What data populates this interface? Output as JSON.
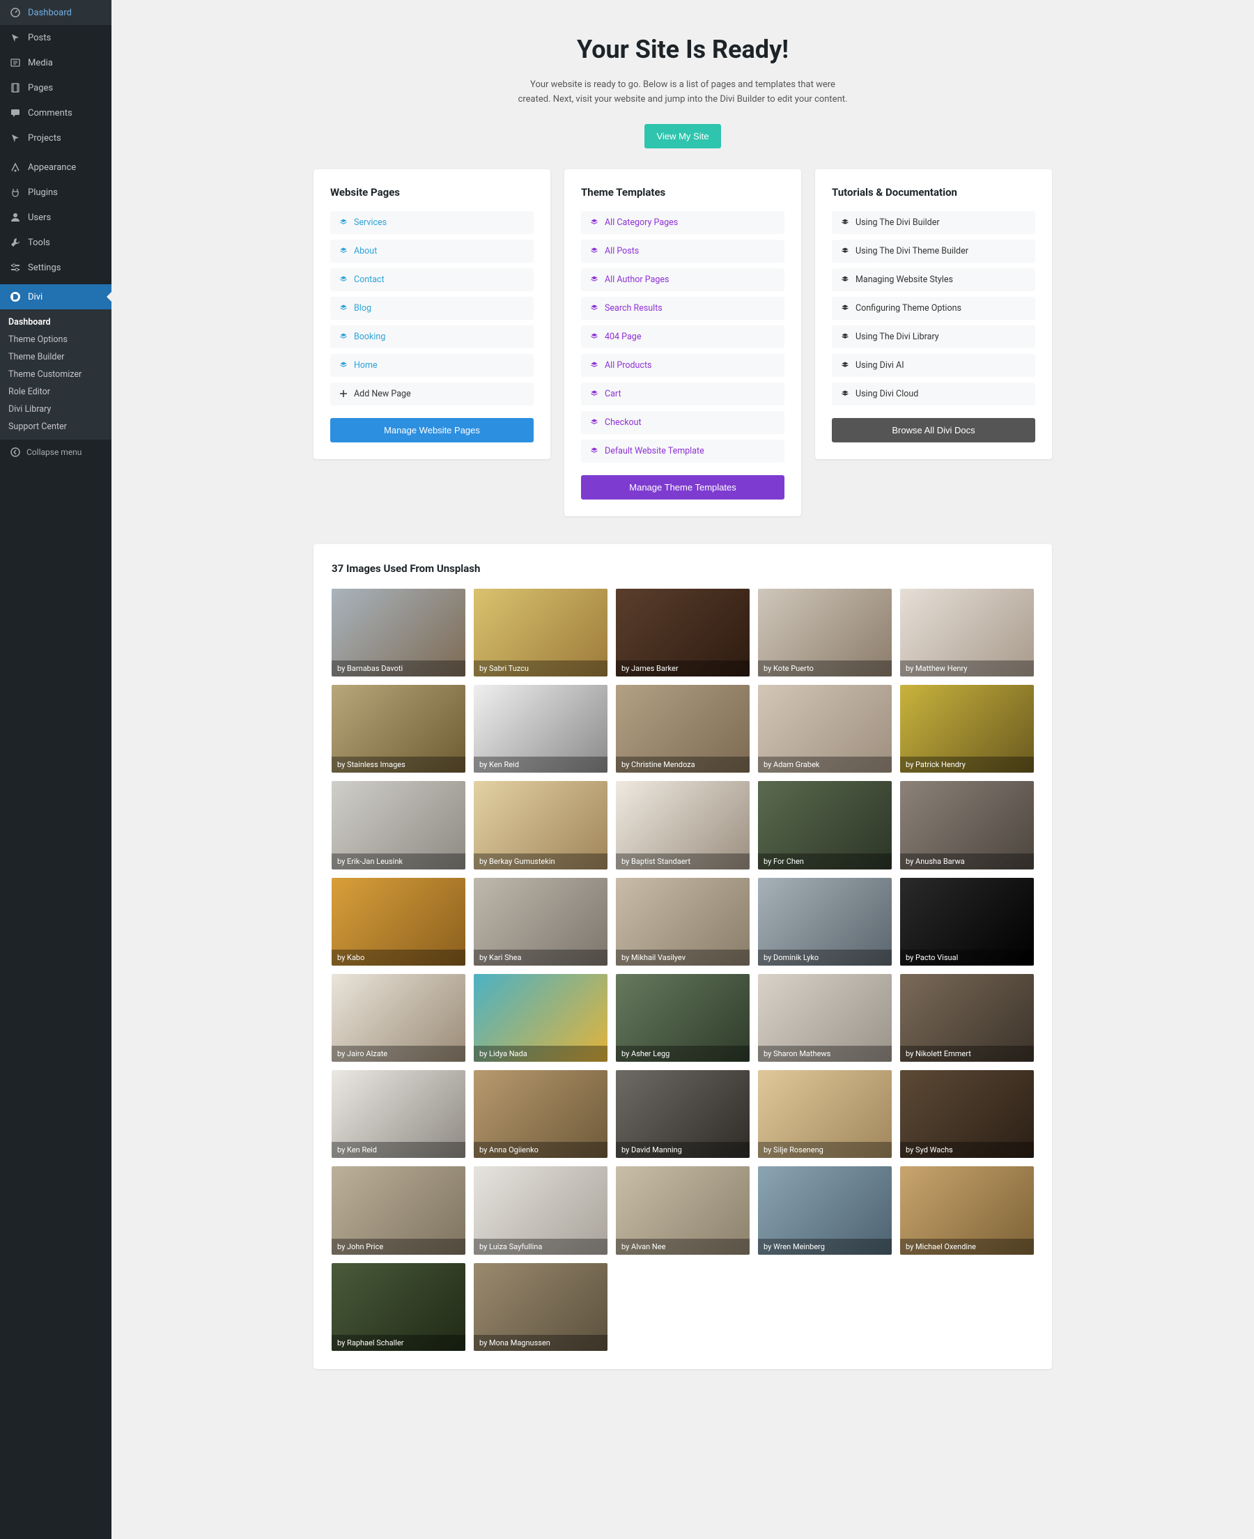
{
  "sidebar": {
    "items": [
      {
        "icon": "dashboard",
        "label": "Dashboard"
      },
      {
        "icon": "pin",
        "label": "Posts"
      },
      {
        "icon": "media",
        "label": "Media"
      },
      {
        "icon": "page",
        "label": "Pages"
      },
      {
        "icon": "comments",
        "label": "Comments"
      },
      {
        "icon": "pin",
        "label": "Projects"
      },
      {
        "icon": "appearance",
        "label": "Appearance"
      },
      {
        "icon": "plugins",
        "label": "Plugins"
      },
      {
        "icon": "users",
        "label": "Users"
      },
      {
        "icon": "tools",
        "label": "Tools"
      },
      {
        "icon": "settings",
        "label": "Settings"
      },
      {
        "icon": "divi",
        "label": "Divi"
      }
    ],
    "active_index": 11,
    "divider_after": [
      5
    ],
    "submenu": {
      "items": [
        "Dashboard",
        "Theme Options",
        "Theme Builder",
        "Theme Customizer",
        "Role Editor",
        "Divi Library",
        "Support Center"
      ],
      "active_index": 0
    },
    "collapse_label": "Collapse menu"
  },
  "hero": {
    "title": "Your Site Is Ready!",
    "subtitle": "Your website is ready to go. Below is a list of pages and templates that were created. Next, visit your website and jump into the Divi Builder to edit your content.",
    "cta": "View My Site"
  },
  "pages_card": {
    "title": "Website Pages",
    "items": [
      "Services",
      "About",
      "Contact",
      "Blog",
      "Booking",
      "Home"
    ],
    "add_new": "Add New Page",
    "button": "Manage Website Pages"
  },
  "templates_card": {
    "title": "Theme Templates",
    "items": [
      "All Category Pages",
      "All Posts",
      "All Author Pages",
      "Search Results",
      "404 Page",
      "All Products",
      "Cart",
      "Checkout",
      "Default Website Template"
    ],
    "button": "Manage Theme Templates"
  },
  "docs_card": {
    "title": "Tutorials & Documentation",
    "items": [
      "Using The Divi Builder",
      "Using The Divi Theme Builder",
      "Managing Website Styles",
      "Configuring Theme Options",
      "Using The Divi Library",
      "Using Divi AI",
      "Using Divi Cloud"
    ],
    "button": "Browse All Divi Docs"
  },
  "images": {
    "title": "37 Images Used From Unsplash",
    "items": [
      {
        "by": "by Barnabas Davoti",
        "g": "#a9b4bd,#7d6a54"
      },
      {
        "by": "by Sabri Tuzcu",
        "g": "#d9c26f,#9d7b3a"
      },
      {
        "by": "by James Barker",
        "g": "#5a3e2c,#2e1b10"
      },
      {
        "by": "by Kote Puerto",
        "g": "#cfc7bb,#8c7c6a"
      },
      {
        "by": "by Matthew Henry",
        "g": "#e6dfd7,#a89a8c"
      },
      {
        "by": "by Stainless Images",
        "g": "#b8a77a,#6e5b33"
      },
      {
        "by": "by Ken Reid",
        "g": "#efefef,#8a8a8a"
      },
      {
        "by": "by Christine Mendoza",
        "g": "#b3a085,#7c6a52"
      },
      {
        "by": "by Adam Grabek",
        "g": "#d3c6b7,#9e8f7e"
      },
      {
        "by": "by Patrick Hendry",
        "g": "#c9b33d,#6a5a1f"
      },
      {
        "by": "by Erik-Jan Leusink",
        "g": "#d0cec9,#8e8b83"
      },
      {
        "by": "by Berkay Gumustekin",
        "g": "#e3d1a3,#a0855a"
      },
      {
        "by": "by Baptist Standaert",
        "g": "#efe9e0,#9b8f80"
      },
      {
        "by": "by For Chen",
        "g": "#5a6a4f,#2c3526"
      },
      {
        "by": "by Anusha Barwa",
        "g": "#8c8279,#4c453e"
      },
      {
        "by": "by Kabo",
        "g": "#d99f3a,#8a5f1e"
      },
      {
        "by": "by Kari Shea",
        "g": "#bfb8ad,#7d766c"
      },
      {
        "by": "by Mikhail Vasilyev",
        "g": "#c9bca8,#8a7d6a"
      },
      {
        "by": "by Dominik Lyko",
        "g": "#a7b1b8,#5b656d"
      },
      {
        "by": "by Pacto Visual",
        "g": "#2a2a2a,#000000"
      },
      {
        "by": "by Jairo Alzate",
        "g": "#eae4da,#9a8b76"
      },
      {
        "by": "by Lidya Nada",
        "g": "#4bb2c4,#e3b33a"
      },
      {
        "by": "by Asher Legg",
        "g": "#667a5f,#2e3b29"
      },
      {
        "by": "by Sharon Mathews",
        "g": "#d8d2c8,#9a9389"
      },
      {
        "by": "by Nikolett Emmert",
        "g": "#7a6a58,#3c332a"
      },
      {
        "by": "by Ken Reid",
        "g": "#ebe8e3,#8e8a83"
      },
      {
        "by": "by Anna Ogiienko",
        "g": "#b89a6e,#6e5a3a"
      },
      {
        "by": "by David Manning",
        "g": "#6e6a64,#2f2c28"
      },
      {
        "by": "by Silje Roseneng",
        "g": "#e0c89a,#a0875c"
      },
      {
        "by": "by Syd Wachs",
        "g": "#5d4a36,#2b1f15"
      },
      {
        "by": "by John Price",
        "g": "#bcb09a,#7e735f"
      },
      {
        "by": "by Luiza Sayfullina",
        "g": "#e6e3de,#a8a39a"
      },
      {
        "by": "by Alvan Nee",
        "g": "#c9bea8,#8c816c"
      },
      {
        "by": "by Wren Meinberg",
        "g": "#8ca5b3,#4d6270"
      },
      {
        "by": "by Michael Oxendine",
        "g": "#c9a56e,#7d6236"
      },
      {
        "by": "by Raphael Schaller",
        "g": "#4a5a3a,#1f2a16"
      },
      {
        "by": "by Mona Magnussen",
        "g": "#9a8a6e,#5c513e"
      }
    ]
  }
}
